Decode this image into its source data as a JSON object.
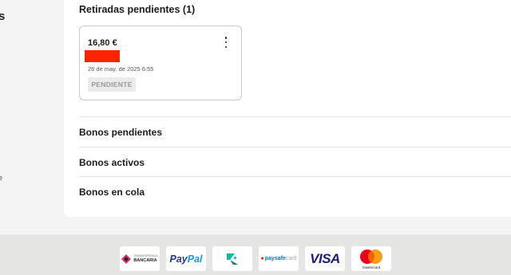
{
  "sidebar": {
    "fragment_top": "s",
    "fragment_bottom": "e"
  },
  "withdrawals": {
    "title": "Retiradas pendientes (1)",
    "items": [
      {
        "amount": "16,80 €",
        "date": "26 de may. de 2025 6:55",
        "status": "PENDIENTE"
      }
    ]
  },
  "sections": [
    {
      "label": "Bonos pendientes"
    },
    {
      "label": "Bonos activos"
    },
    {
      "label": "Bonos en cola"
    }
  ],
  "footer": {
    "payment_methods": [
      {
        "name": "transferencia-bancaria",
        "line1": "TRANSFERENCIA",
        "line2": "BANCARIA"
      },
      {
        "name": "paypal",
        "part1": "Pay",
        "part2": "Pal"
      },
      {
        "name": "skrill"
      },
      {
        "name": "paysafecard",
        "part1": "paysafe",
        "part2": "card"
      },
      {
        "name": "visa",
        "label": "VISA"
      },
      {
        "name": "mastercard",
        "label": "mastercard"
      }
    ]
  },
  "colors": {
    "redaction": "#ff2200",
    "paypal_dark": "#253b80",
    "paypal_light": "#179bd7",
    "visa_blue": "#1a1f71",
    "mastercard_red": "#eb001b",
    "mastercard_orange": "#f79e1b"
  }
}
